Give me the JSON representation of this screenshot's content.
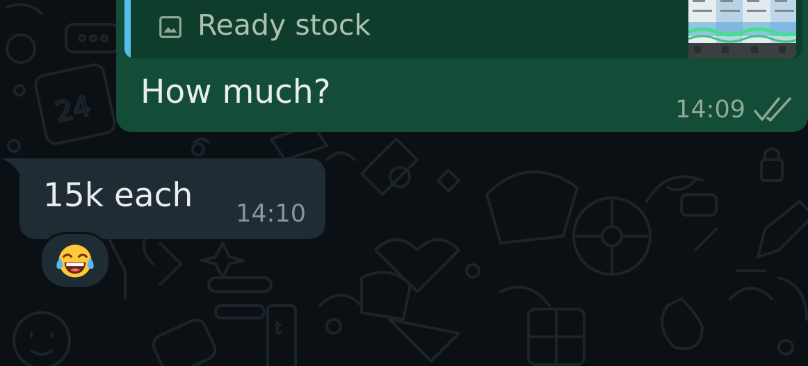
{
  "conversation": {
    "outgoing": {
      "quoted": {
        "icon": "image-icon",
        "text": "Ready stock"
      },
      "text": "How much?",
      "time": "14:09",
      "status_icon": "double-check-icon"
    },
    "incoming": {
      "text": "15k each",
      "time": "14:10",
      "reaction": "😂"
    }
  },
  "colors": {
    "background": "#0b1014",
    "outgoing_bubble": "#144d37",
    "incoming_bubble": "#1f2c34",
    "quote_accent": "#53bdeb"
  }
}
